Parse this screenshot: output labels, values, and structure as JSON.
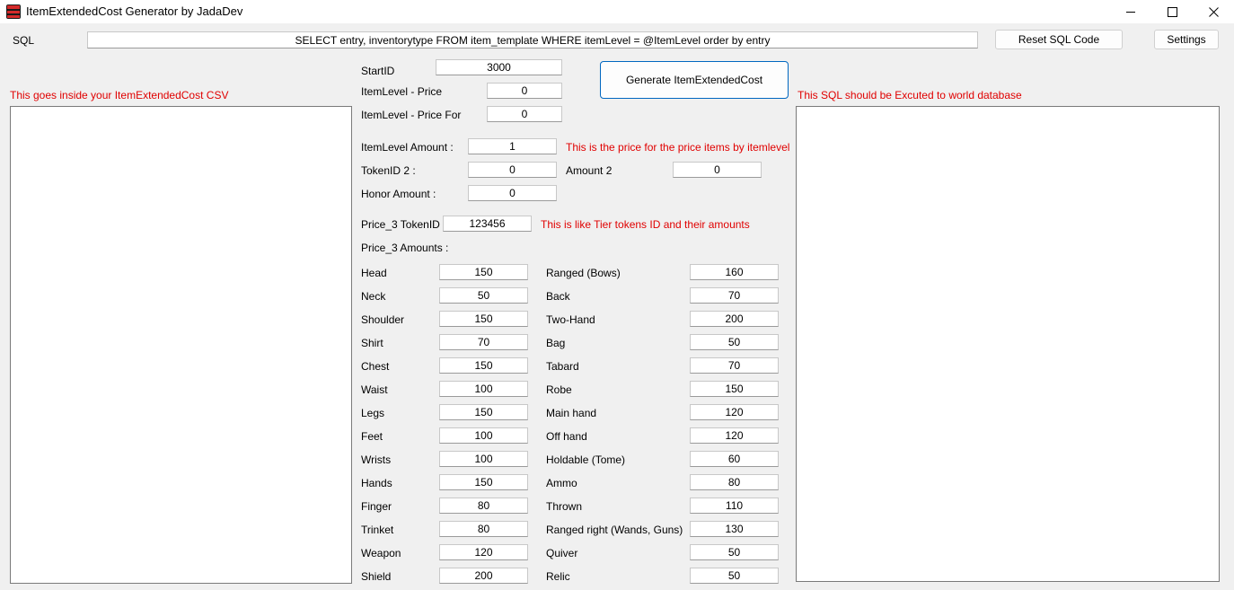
{
  "window": {
    "title": "ItemExtendedCost Generator by JadaDev"
  },
  "toolbar": {
    "sql_label": "SQL",
    "sql_value": "SELECT entry, inventorytype FROM item_template WHERE itemLevel = @ItemLevel order by entry",
    "reset_label": "Reset SQL Code",
    "settings_label": "Settings"
  },
  "left_panel": {
    "hint": "This goes inside your ItemExtendedCost CSV",
    "content": ""
  },
  "right_panel": {
    "hint": "This SQL should be Excuted to world database",
    "content": ""
  },
  "form": {
    "start_id_label": "StartID",
    "start_id_value": "3000",
    "price_label": "ItemLevel - Price",
    "price_value": "0",
    "price_for_label": "ItemLevel - Price For",
    "price_for_value": "0",
    "generate_label": "Generate ItemExtendedCost",
    "amount_label": "ItemLevel Amount :",
    "amount_value": "1",
    "amount_note": "This is the price for the price items by itemlevel",
    "token2_label": "TokenID 2 :",
    "token2_value": "0",
    "amount2_label": "Amount 2",
    "amount2_value": "0",
    "honor_label": "Honor Amount :",
    "honor_value": "0",
    "price3_label": "Price_3 TokenID",
    "price3_value": "123456",
    "price3_note": "This is like Tier tokens ID and their amounts",
    "price3_amounts_label": "Price_3 Amounts :"
  },
  "slots_left": [
    {
      "label": "Head",
      "value": "150"
    },
    {
      "label": "Neck",
      "value": "50"
    },
    {
      "label": "Shoulder",
      "value": "150"
    },
    {
      "label": "Shirt",
      "value": "70"
    },
    {
      "label": "Chest",
      "value": "150"
    },
    {
      "label": "Waist",
      "value": "100"
    },
    {
      "label": "Legs",
      "value": "150"
    },
    {
      "label": "Feet",
      "value": "100"
    },
    {
      "label": "Wrists",
      "value": "100"
    },
    {
      "label": "Hands",
      "value": "150"
    },
    {
      "label": "Finger",
      "value": "80"
    },
    {
      "label": "Trinket",
      "value": "80"
    },
    {
      "label": "Weapon",
      "value": "120"
    },
    {
      "label": "Shield",
      "value": "200"
    }
  ],
  "slots_right": [
    {
      "label": "Ranged (Bows)",
      "value": "160"
    },
    {
      "label": "Back",
      "value": "70"
    },
    {
      "label": "Two-Hand",
      "value": "200"
    },
    {
      "label": "Bag",
      "value": "50"
    },
    {
      "label": "Tabard",
      "value": "70"
    },
    {
      "label": "Robe",
      "value": "150"
    },
    {
      "label": "Main hand",
      "value": "120"
    },
    {
      "label": "Off hand",
      "value": "120"
    },
    {
      "label": "Holdable (Tome)",
      "value": "60"
    },
    {
      "label": "Ammo",
      "value": "80"
    },
    {
      "label": "Thrown",
      "value": "110"
    },
    {
      "label": "Ranged right (Wands, Guns)",
      "value": "130"
    },
    {
      "label": "Quiver",
      "value": "50"
    },
    {
      "label": "Relic",
      "value": "50"
    }
  ]
}
